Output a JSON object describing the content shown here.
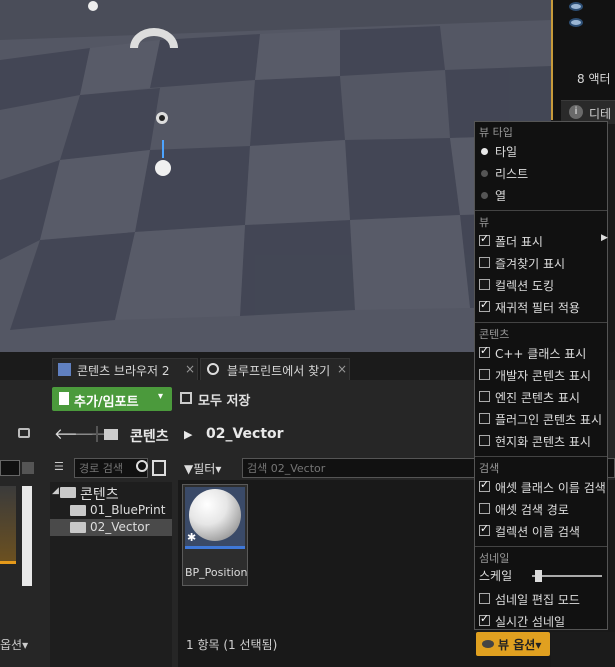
{
  "outliner": {
    "actor_count": "8 액터"
  },
  "details_tab": {
    "label": "디테"
  },
  "tabs": [
    {
      "label": "콘텐츠 브라우저 2",
      "close": "×"
    },
    {
      "label": "블루프린트에서 찾기",
      "close": "×"
    }
  ],
  "toolbar": {
    "add_import": "추가/임포트",
    "save_all": "모두 저장"
  },
  "nav": {
    "root": "콘텐츠",
    "current": "02_Vector"
  },
  "sources": {
    "search_placeholder": "경로 검색",
    "tree": [
      {
        "label": "콘텐츠"
      },
      {
        "label": "01_BluePrint"
      },
      {
        "label": "02_Vector"
      }
    ]
  },
  "filter": {
    "label": "필터",
    "search_placeholder": "검색 02_Vector"
  },
  "assets": [
    {
      "name": "BP_Position"
    }
  ],
  "status": {
    "text": "1 항목 (1 선택됨)"
  },
  "view_options_button": {
    "label": "뷰 옵션"
  },
  "left_panel": {
    "view_options": "옵션"
  },
  "menu": {
    "view_type_header": "뷰 타입",
    "view_types": [
      {
        "label": "타일",
        "selected": true
      },
      {
        "label": "리스트",
        "selected": false
      },
      {
        "label": "열",
        "selected": false
      }
    ],
    "view_header": "뷰",
    "view_items": [
      {
        "label": "폴더 표시",
        "checked": true
      },
      {
        "label": "즐겨찾기 표시",
        "checked": false
      },
      {
        "label": "컬렉션 도킹",
        "checked": false
      },
      {
        "label": "재귀적 필터 적용",
        "checked": true
      }
    ],
    "content_header": "콘텐츠",
    "content_items": [
      {
        "label": "C++ 클래스 표시",
        "checked": true
      },
      {
        "label": "개발자 콘텐츠 표시",
        "checked": false
      },
      {
        "label": "엔진 콘텐츠 표시",
        "checked": false
      },
      {
        "label": "플러그인 콘텐츠 표시",
        "checked": false
      },
      {
        "label": "현지화 콘텐츠 표시",
        "checked": false
      }
    ],
    "search_header": "검색",
    "search_items": [
      {
        "label": "애셋 클래스 이름 검색",
        "checked": true
      },
      {
        "label": "애셋 검색 경로",
        "checked": false
      },
      {
        "label": "컬렉션 이름 검색",
        "checked": true
      }
    ],
    "thumbnail_header": "섬네일",
    "scale_label": "스케일",
    "scale_value": 0.08,
    "thumbnail_items": [
      {
        "label": "섬네일 편집 모드",
        "checked": false
      },
      {
        "label": "실시간 섬네일",
        "checked": true
      }
    ]
  }
}
